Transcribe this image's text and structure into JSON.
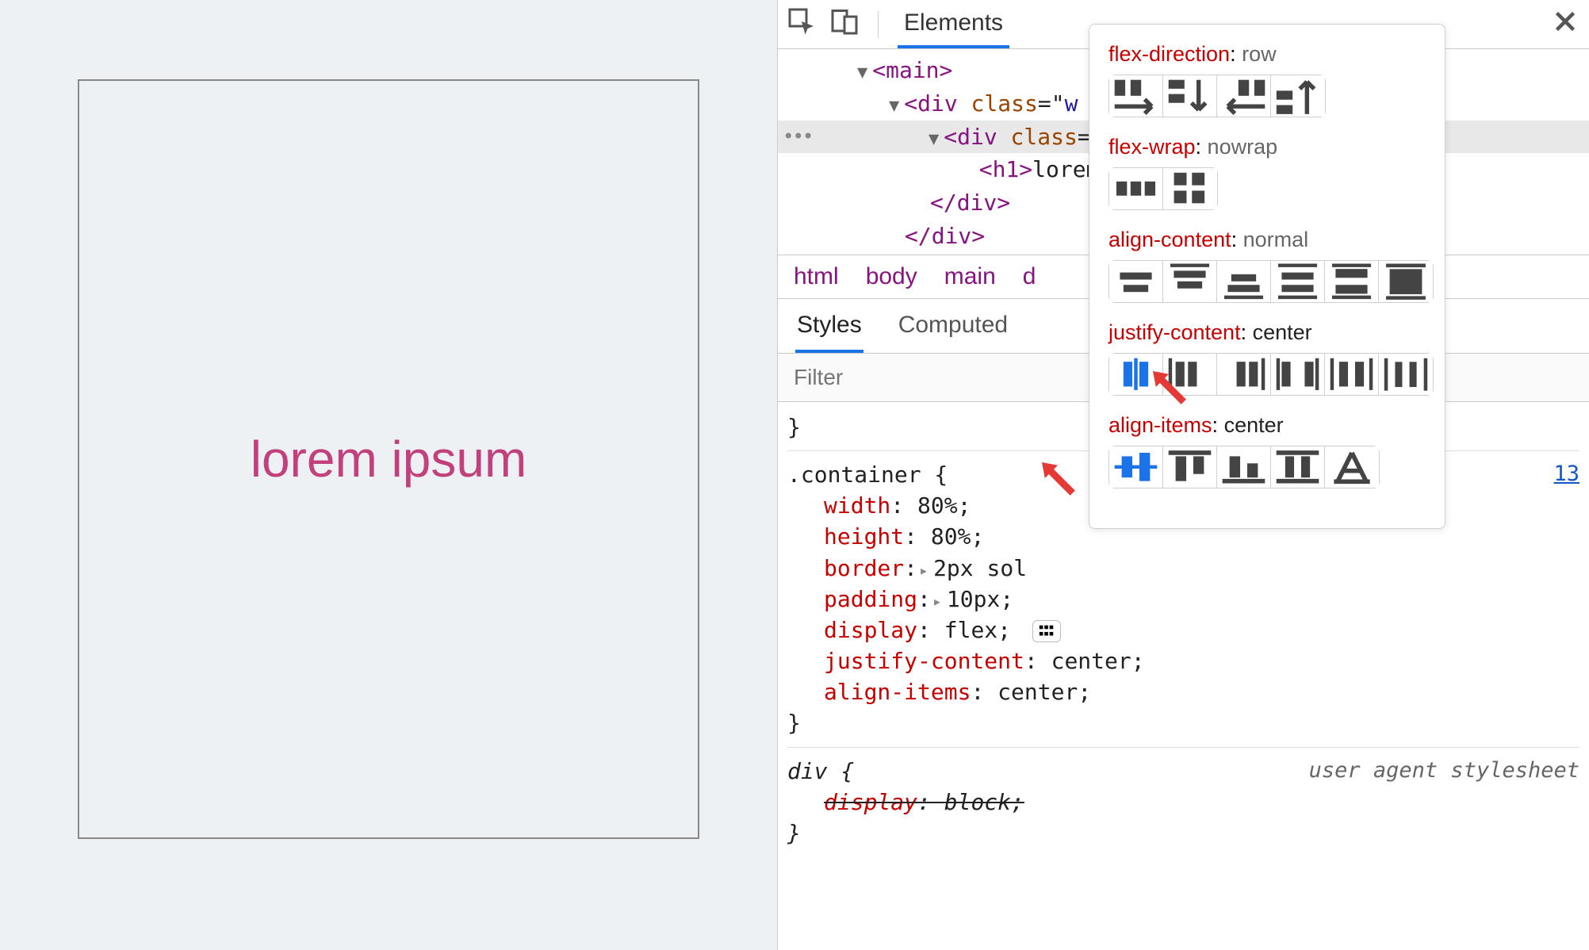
{
  "preview": {
    "heading": "lorem ipsum"
  },
  "toolbar": {
    "tab_elements": "Elements"
  },
  "dom": {
    "rows": [
      "<main>",
      "<div class=\"w",
      "<div class=",
      "<h1>lorem",
      "</div>",
      "</div>"
    ]
  },
  "breadcrumb": [
    "html",
    "body",
    "main",
    "d"
  ],
  "subtabs": {
    "styles": "Styles",
    "computed": "Computed"
  },
  "filter_placeholder": "Filter",
  "styleRules": {
    "container_selector": ".container {",
    "p_width_k": "width",
    "p_width_v": "80%",
    "p_height_k": "height",
    "p_height_v": "80%",
    "p_border_k": "border",
    "p_border_v": "2px sol",
    "p_padding_k": "padding",
    "p_padding_v": "10px",
    "p_display_k": "display",
    "p_display_v": "flex",
    "p_jc_k": "justify-content",
    "p_jc_v": "center",
    "p_ai_k": "align-items",
    "p_ai_v": "center",
    "close": "}",
    "div_selector": "div {",
    "div_display_k": "display",
    "div_display_v": "block",
    "ua": "user agent stylesheet",
    "link": "13"
  },
  "flexpop": {
    "flex_direction": {
      "k": "flex-direction",
      "v": "row"
    },
    "flex_wrap": {
      "k": "flex-wrap",
      "v": "nowrap"
    },
    "align_content": {
      "k": "align-content",
      "v": "normal"
    },
    "justify_content": {
      "k": "justify-content",
      "v": "center"
    },
    "align_items": {
      "k": "align-items",
      "v": "center"
    }
  }
}
